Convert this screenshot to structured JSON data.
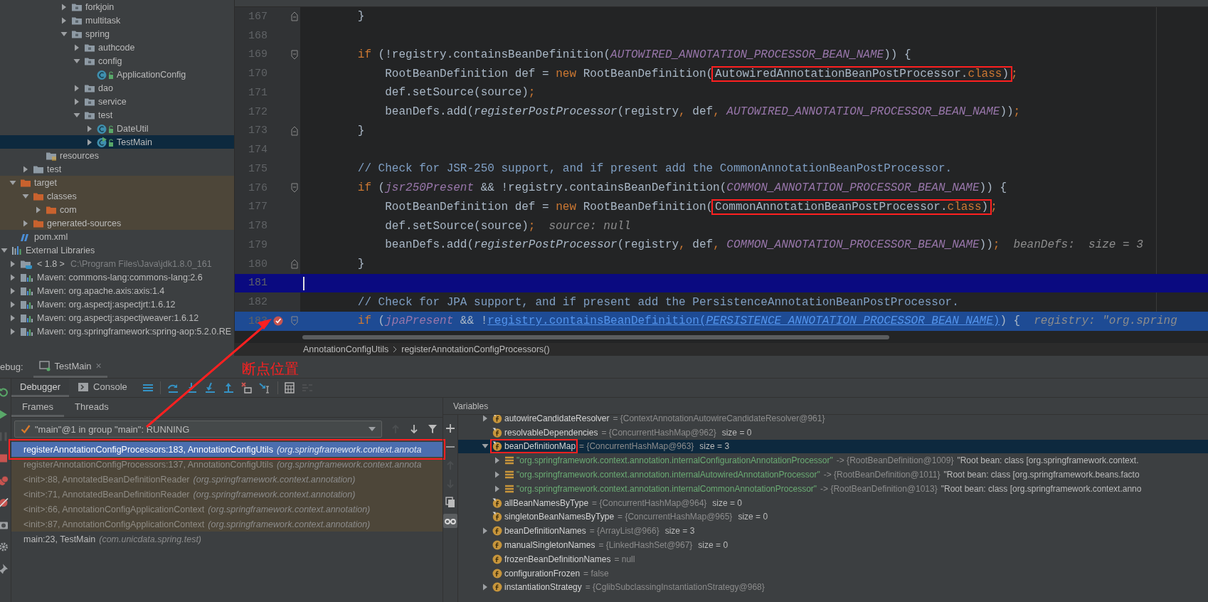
{
  "project_tree": [
    {
      "children": [
        {
          "children": [
            {
              "children": [
                {
                  "children": [
                    {
                      "children": [
                        {
                          "label": "forkjoin",
                          "kind": "package",
                          "expanded": false,
                          "selected": false
                        },
                        {
                          "label": "multitask",
                          "kind": "package",
                          "expanded": false,
                          "selected": false
                        },
                        {
                          "label": "spring",
                          "kind": "package",
                          "expanded": true,
                          "selected": false,
                          "children": [
                            {
                              "label": "authcode",
                              "kind": "package",
                              "expanded": false,
                              "selected": false
                            },
                            {
                              "label": "config",
                              "kind": "package",
                              "expanded": true,
                              "selected": false,
                              "children": [
                                {
                                  "label": "ApplicationConfig",
                                  "kind": "class",
                                  "selected": false
                                }
                              ]
                            },
                            {
                              "label": "dao",
                              "kind": "package",
                              "expanded": false,
                              "selected": false
                            },
                            {
                              "label": "service",
                              "kind": "package",
                              "expanded": false,
                              "selected": false
                            },
                            {
                              "label": "test",
                              "kind": "package",
                              "expanded": true,
                              "selected": false,
                              "children": [
                                {
                                  "label": "DateUtil",
                                  "kind": "class",
                                  "expanded": false,
                                  "selected": false
                                },
                                {
                                  "label": "TestMain",
                                  "kind": "main-class",
                                  "expanded": false,
                                  "selected": true
                                }
                              ]
                            }
                          ]
                        }
                      ]
                    }
                  ]
                },
                {
                  "label": "resources",
                  "kind": "resources",
                  "selected": false
                }
              ]
            },
            {
              "label": "test",
              "kind": "folder",
              "expanded": false,
              "selected": false
            }
          ]
        },
        {
          "label": "target",
          "kind": "excluded-folder",
          "expanded": true,
          "selected": false,
          "children": [
            {
              "label": "classes",
              "kind": "excluded-folder",
              "expanded": true,
              "selected": false,
              "children": [
                {
                  "label": "com",
                  "kind": "excluded-folder",
                  "expanded": false,
                  "selected": false
                }
              ]
            },
            {
              "label": "generated-sources",
              "kind": "excluded-folder",
              "expanded": false,
              "selected": false
            }
          ]
        },
        {
          "label": "pom.xml",
          "kind": "pom",
          "selected": false
        }
      ]
    },
    {
      "label": "External Libraries",
      "kind": "libraries",
      "expanded": true,
      "selected": false,
      "children": [
        {
          "label": "< 1.8 >",
          "path": "C:\\Program Files\\Java\\jdk1.8.0_161",
          "kind": "jdk",
          "expanded": false,
          "selected": false
        },
        {
          "label": "Maven: commons-lang:commons-lang:2.6",
          "kind": "library",
          "expanded": false,
          "selected": false
        },
        {
          "label": "Maven: org.apache.axis:axis:1.4",
          "kind": "library",
          "expanded": false,
          "selected": false
        },
        {
          "label": "Maven: org.aspectj:aspectjrt:1.6.12",
          "kind": "library",
          "expanded": false,
          "selected": false
        },
        {
          "label": "Maven: org.aspectj:aspectjweaver:1.6.12",
          "kind": "library",
          "expanded": false,
          "selected": false
        },
        {
          "label": "Maven: org.springframework:spring-aop:5.2.0.RE",
          "kind": "library",
          "expanded": false,
          "selected": false
        }
      ]
    }
  ],
  "code_lines": [
    {
      "number": "167",
      "kind": "plain",
      "fold_start": false,
      "fold_end": true,
      "breakpoint": false,
      "tokens": [
        {
          "kind": "plain",
          "t": "        }"
        }
      ]
    },
    {
      "number": "168",
      "kind": "plain",
      "fold_start": false,
      "fold_end": false,
      "breakpoint": false
    },
    {
      "number": "169",
      "kind": "plain",
      "fold_start": true,
      "fold_end": false,
      "breakpoint": false,
      "tokens": [
        {
          "kind": "kw",
          "t": "        if"
        },
        {
          "kind": "plain",
          "t": " (!registry.containsBeanDefinition("
        },
        {
          "kind": "const",
          "t": "AUTOWIRED_ANNOTATION_PROCESSOR_BEAN_NAME"
        },
        {
          "kind": "plain",
          "t": ")) {"
        }
      ]
    },
    {
      "number": "170",
      "kind": "plain",
      "fold_start": false,
      "fold_end": false,
      "breakpoint": false,
      "tokens": [
        {
          "kind": "plain",
          "t": "            RootBeanDefinition def = "
        },
        {
          "kind": "kw",
          "t": "new"
        },
        {
          "kind": "plain",
          "t": " RootBeanDefinition("
        },
        {
          "box": [
            {
              "kind": "plain",
              "t": "AutowiredAnnotationBeanPostProcessor."
            },
            {
              "kind": "kw",
              "t": "class"
            },
            {
              "kind": "plain",
              "t": ")"
            }
          ]
        },
        {
          "kind": "kw",
          "t": ";"
        }
      ]
    },
    {
      "number": "171",
      "kind": "plain",
      "fold_start": false,
      "fold_end": false,
      "breakpoint": false,
      "tokens": [
        {
          "kind": "plain",
          "t": "            def.setSource(source)"
        },
        {
          "kind": "kw",
          "t": ";"
        }
      ]
    },
    {
      "number": "172",
      "kind": "plain",
      "fold_start": false,
      "fold_end": false,
      "breakpoint": false,
      "tokens": [
        {
          "kind": "plain",
          "t": "            beanDefs.add("
        },
        {
          "kind": "italic",
          "t": "registerPostProcessor"
        },
        {
          "kind": "plain",
          "t": "(registry"
        },
        {
          "kind": "kw",
          "t": ", "
        },
        {
          "kind": "plain",
          "t": "def"
        },
        {
          "kind": "kw",
          "t": ", "
        },
        {
          "kind": "const",
          "t": "AUTOWIRED_ANNOTATION_PROCESSOR_BEAN_NAME"
        },
        {
          "kind": "plain",
          "t": "))"
        },
        {
          "kind": "kw",
          "t": ";"
        }
      ]
    },
    {
      "number": "173",
      "kind": "plain",
      "fold_start": false,
      "fold_end": true,
      "breakpoint": false,
      "tokens": [
        {
          "kind": "plain",
          "t": "        }"
        }
      ]
    },
    {
      "number": "174",
      "kind": "plain",
      "fold_start": false,
      "fold_end": false,
      "breakpoint": false
    },
    {
      "number": "175",
      "kind": "plain",
      "fold_start": false,
      "fold_end": false,
      "breakpoint": false,
      "tokens": [
        {
          "kind": "comment",
          "t": "        // Check for JSR-250 support, and if present add the CommonAnnotationBeanPostProcessor."
        }
      ]
    },
    {
      "number": "176",
      "kind": "plain",
      "fold_start": true,
      "fold_end": false,
      "breakpoint": false,
      "tokens": [
        {
          "kind": "kw",
          "t": "        if"
        },
        {
          "kind": "plain",
          "t": " ("
        },
        {
          "kind": "field",
          "t": "jsr250Present"
        },
        {
          "kind": "plain",
          "t": " && !registry.containsBeanDefinition("
        },
        {
          "kind": "const",
          "t": "COMMON_ANNOTATION_PROCESSOR_BEAN_NAME"
        },
        {
          "kind": "plain",
          "t": ")) {"
        }
      ]
    },
    {
      "number": "177",
      "kind": "plain",
      "fold_start": false,
      "fold_end": false,
      "breakpoint": false,
      "tokens": [
        {
          "kind": "plain",
          "t": "            RootBeanDefinition def = "
        },
        {
          "kind": "kw",
          "t": "new"
        },
        {
          "kind": "plain",
          "t": " RootBeanDefinition("
        },
        {
          "box": [
            {
              "kind": "plain",
              "t": "CommonAnnotationBeanPostProcessor."
            },
            {
              "kind": "kw",
              "t": "class"
            },
            {
              "kind": "plain",
              "t": ")"
            }
          ]
        },
        {
          "kind": "kw",
          "t": ";"
        }
      ]
    },
    {
      "number": "178",
      "kind": "plain",
      "fold_start": false,
      "fold_end": false,
      "breakpoint": false,
      "tokens": [
        {
          "kind": "plain",
          "t": "            def.setSource(source)"
        },
        {
          "kind": "kw",
          "t": ";"
        }
      ],
      "inline_value": "source: null"
    },
    {
      "number": "179",
      "kind": "plain",
      "fold_start": false,
      "fold_end": false,
      "breakpoint": false,
      "tokens": [
        {
          "kind": "plain",
          "t": "            beanDefs.add("
        },
        {
          "kind": "italic",
          "t": "registerPostProcessor"
        },
        {
          "kind": "plain",
          "t": "(registry"
        },
        {
          "kind": "kw",
          "t": ", "
        },
        {
          "kind": "plain",
          "t": "def"
        },
        {
          "kind": "kw",
          "t": ", "
        },
        {
          "kind": "const",
          "t": "COMMON_ANNOTATION_PROCESSOR_BEAN_NAME"
        },
        {
          "kind": "plain",
          "t": "))"
        },
        {
          "kind": "kw",
          "t": ";"
        }
      ],
      "inline_value": "beanDefs:  size = 3"
    },
    {
      "number": "180",
      "kind": "plain",
      "fold_start": false,
      "fold_end": true,
      "breakpoint": false,
      "tokens": [
        {
          "kind": "plain",
          "t": "        }"
        }
      ]
    },
    {
      "number": "181",
      "kind": "caret",
      "fold_start": false,
      "fold_end": false,
      "breakpoint": false
    },
    {
      "number": "182",
      "kind": "plain",
      "fold_start": false,
      "fold_end": false,
      "breakpoint": false,
      "tokens": [
        {
          "kind": "comment",
          "t": "        // Check for JPA support, and if present add the PersistenceAnnotationBeanPostProcessor."
        }
      ]
    },
    {
      "number": "183",
      "kind": "execution",
      "fold_start": true,
      "fold_end": false,
      "breakpoint": true,
      "tokens": [
        {
          "kind": "kw",
          "t": "        if"
        },
        {
          "kind": "plain",
          "t": " ("
        },
        {
          "kind": "field",
          "t": "jpaPresent"
        },
        {
          "kind": "plain",
          "t": " && !"
        },
        {
          "kind": "link",
          "t": "registry.containsBeanDefinition("
        },
        {
          "kind": "linkconst",
          "t": "PERSISTENCE_ANNOTATION_PROCESSOR_BEAN_NAME"
        },
        {
          "kind": "link",
          "t": ")"
        },
        {
          "kind": "plain",
          "t": ") {"
        }
      ],
      "inline_value": "registry: \"org.spring"
    }
  ],
  "breadcrumbs": [
    {
      "label": "AnnotationConfigUtils"
    },
    {
      "label": "registerAnnotationConfigProcessors()"
    }
  ],
  "debug": {
    "title": "ebug:",
    "session_tab": {
      "label": "TestMain",
      "close": "×"
    },
    "side_toolbar": [
      {
        "kind": "rerun",
        "disabled": false
      },
      {
        "kind": "resume",
        "disabled": false
      },
      {
        "kind": "pause",
        "disabled": true
      },
      {
        "kind": "stop",
        "disabled": false
      },
      {
        "kind": "breakpoints",
        "disabled": false
      },
      {
        "kind": "mute",
        "disabled": false
      },
      {
        "kind": "camera",
        "disabled": false
      },
      {
        "kind": "settings",
        "disabled": false
      },
      {
        "kind": "pin",
        "disabled": false
      }
    ],
    "tabs": [
      {
        "label": "Debugger",
        "kind": "debugger",
        "selected": true
      },
      {
        "label": "Console",
        "kind": "console",
        "selected": false
      }
    ],
    "toolbar": [
      {
        "kind": "frames-menu",
        "disabled": false
      },
      {
        "kind": "step-over",
        "disabled": false
      },
      {
        "kind": "step-into",
        "disabled": false
      },
      {
        "kind": "force-step-into",
        "disabled": false
      },
      {
        "kind": "step-out",
        "disabled": false
      },
      {
        "kind": "drop-frame",
        "disabled": false
      },
      {
        "kind": "run-to-cursor",
        "disabled": false
      },
      {
        "kind": "evaluate",
        "disabled": false
      },
      {
        "kind": "trace",
        "disabled": true
      }
    ],
    "frame_tabs": [
      {
        "label": "Frames",
        "selected": true
      },
      {
        "label": "Threads",
        "selected": false
      }
    ],
    "thread": "\"main\"@1 in group \"main\": RUNNING",
    "frame_toolbar": [
      {
        "kind": "up",
        "disabled": true
      },
      {
        "kind": "down",
        "disabled": false
      },
      {
        "kind": "filter",
        "disabled": false
      }
    ],
    "frames": [
      {
        "method": "registerAnnotationConfigProcessors:183, AnnotationConfigUtils",
        "package": "(org.springframework.context.annota",
        "kind": "library",
        "selected": true,
        "boxed": true
      },
      {
        "method": "registerAnnotationConfigProcessors:137, AnnotationConfigUtils",
        "package": "(org.springframework.context.annota",
        "kind": "library",
        "selected": false,
        "boxed": false
      },
      {
        "method": "<init>:88, AnnotatedBeanDefinitionReader",
        "package": "(org.springframework.context.annotation)",
        "kind": "library",
        "selected": false,
        "boxed": false
      },
      {
        "method": "<init>:71, AnnotatedBeanDefinitionReader",
        "package": "(org.springframework.context.annotation)",
        "kind": "library",
        "selected": false,
        "boxed": false
      },
      {
        "method": "<init>:66, AnnotationConfigApplicationContext",
        "package": "(org.springframework.context.annotation)",
        "kind": "library",
        "selected": false,
        "boxed": false
      },
      {
        "method": "<init>:87, AnnotationConfigApplicationContext",
        "package": "(org.springframework.context.annotation)",
        "kind": "library",
        "selected": false,
        "boxed": false
      },
      {
        "method": "main:23, TestMain",
        "package": "(com.unicdata.spring.test)",
        "kind": "user",
        "selected": false,
        "boxed": false
      }
    ],
    "variables_title": "Variables",
    "variables_toolbar": [
      {
        "kind": "add",
        "disabled": false,
        "on": false
      },
      {
        "kind": "remove",
        "disabled": false,
        "on": false
      },
      {
        "kind": "up",
        "disabled": true,
        "on": false
      },
      {
        "kind": "down",
        "disabled": true,
        "on": false
      },
      {
        "kind": "duplicate",
        "disabled": false,
        "on": false
      },
      {
        "kind": "watches",
        "disabled": false,
        "on": true
      }
    ],
    "variables": [
      {
        "children": [
          {
            "name": "autowireCandidateResolver",
            "kind": "final-field",
            "expanded": false,
            "selected": false,
            "boxed": false,
            "value": "= {ContextAnnotationAutowireCandidateResolver@961}"
          },
          {
            "name": "resolvableDependencies",
            "kind": "final-field",
            "selected": false,
            "boxed": false,
            "value": "= {ConcurrentHashMap@962}",
            "size": "size = 0"
          },
          {
            "name": "beanDefinitionMap",
            "kind": "final-field",
            "expanded": true,
            "selected": true,
            "boxed": true,
            "value": "= {ConcurrentHashMap@963}",
            "size": "size = 3",
            "children": [
              {
                "name": "\"org.springframework.context.annotation.internalConfigurationAnnotationProcessor\"",
                "kind": "entry",
                "expanded": false,
                "selected": false,
                "boxed": false,
                "value": "-> {RootBeanDefinition@1009}",
                "detail": "\"Root bean: class [org.springframework.context."
              },
              {
                "name": "\"org.springframework.context.annotation.internalAutowiredAnnotationProcessor\"",
                "kind": "entry",
                "expanded": false,
                "selected": false,
                "boxed": false,
                "value": "-> {RootBeanDefinition@1011}",
                "detail": "\"Root bean: class [org.springframework.beans.facto"
              },
              {
                "name": "\"org.springframework.context.annotation.internalCommonAnnotationProcessor\"",
                "kind": "entry",
                "expanded": false,
                "selected": false,
                "boxed": false,
                "value": "-> {RootBeanDefinition@1013}",
                "detail": "\"Root bean: class [org.springframework.context.anno"
              }
            ]
          },
          {
            "name": "allBeanNamesByType",
            "kind": "final-field",
            "selected": false,
            "boxed": false,
            "value": "= {ConcurrentHashMap@964}",
            "size": "size = 0"
          },
          {
            "name": "singletonBeanNamesByType",
            "kind": "final-field",
            "selected": false,
            "boxed": false,
            "value": "= {ConcurrentHashMap@965}",
            "size": "size = 0"
          },
          {
            "name": "beanDefinitionNames",
            "kind": "field",
            "expanded": false,
            "selected": false,
            "boxed": false,
            "value": "= {ArrayList@966}",
            "size": "size = 3"
          },
          {
            "name": "manualSingletonNames",
            "kind": "field",
            "selected": false,
            "boxed": false,
            "value": "= {LinkedHashSet@967}",
            "size": "size = 0"
          },
          {
            "name": "frozenBeanDefinitionNames",
            "kind": "field",
            "selected": false,
            "boxed": false,
            "value": "= null"
          },
          {
            "name": "configurationFrozen",
            "kind": "field",
            "selected": false,
            "boxed": false,
            "value": "= false"
          },
          {
            "name": "instantiationStrategy",
            "kind": "field",
            "expanded": false,
            "selected": false,
            "boxed": false,
            "value": "= {CglibSubclassingInstantiationStrategy@968}"
          }
        ]
      }
    ]
  },
  "annotation": {
    "label": "断点位置"
  }
}
